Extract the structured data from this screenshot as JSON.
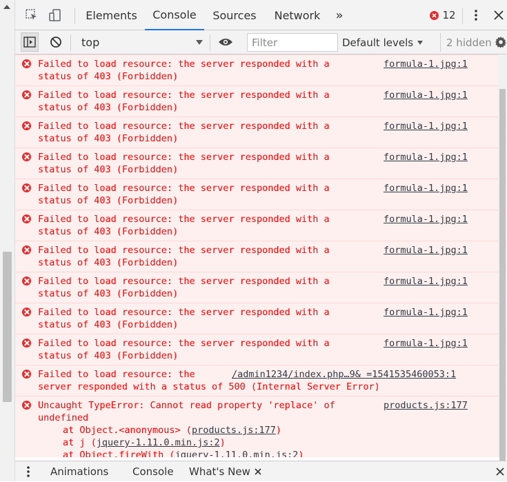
{
  "tabs": [
    {
      "label": "Elements"
    },
    {
      "label": "Console"
    },
    {
      "label": "Sources"
    },
    {
      "label": "Network"
    }
  ],
  "tabs_overflow": "»",
  "error_count": "12",
  "toolbar": {
    "context": "top",
    "filter_placeholder": "Filter",
    "levels": "Default levels",
    "hidden": "2 hidden"
  },
  "messages": [
    {
      "line1": "Failed to load resource: the server responded with a",
      "line2": "status of 403 (Forbidden)",
      "source": "formula-1.jpg:1"
    },
    {
      "line1": "Failed to load resource: the server responded with a",
      "line2": "status of 403 (Forbidden)",
      "source": "formula-1.jpg:1"
    },
    {
      "line1": "Failed to load resource: the server responded with a",
      "line2": "status of 403 (Forbidden)",
      "source": "formula-1.jpg:1"
    },
    {
      "line1": "Failed to load resource: the server responded with a",
      "line2": "status of 403 (Forbidden)",
      "source": "formula-1.jpg:1"
    },
    {
      "line1": "Failed to load resource: the server responded with a",
      "line2": "status of 403 (Forbidden)",
      "source": "formula-1.jpg:1"
    },
    {
      "line1": "Failed to load resource: the server responded with a",
      "line2": "status of 403 (Forbidden)",
      "source": "formula-1.jpg:1"
    },
    {
      "line1": "Failed to load resource: the server responded with a",
      "line2": "status of 403 (Forbidden)",
      "source": "formula-1.jpg:1"
    },
    {
      "line1": "Failed to load resource: the server responded with a",
      "line2": "status of 403 (Forbidden)",
      "source": "formula-1.jpg:1"
    },
    {
      "line1": "Failed to load resource: the server responded with a",
      "line2": "status of 403 (Forbidden)",
      "source": "formula-1.jpg:1"
    },
    {
      "line1": "Failed to load resource: the server responded with a",
      "line2": "status of 403 (Forbidden)",
      "source": "formula-1.jpg:1"
    },
    {
      "line1": "Failed to load resource: the",
      "line2": "server responded with a status of 500 (Internal Server Error)",
      "source": "/admin1234/index.php…9& =1541535460053:1"
    }
  ],
  "uncaught": {
    "line1": "Uncaught TypeError: Cannot read property 'replace' of",
    "line2": "undefined",
    "source": "products.js:177",
    "stack": [
      {
        "prefix": "at Object.<anonymous> (",
        "link": "products.js:177",
        "suffix": ")"
      },
      {
        "prefix": "at j (",
        "link": "jquery-1.11.0.min.js:2",
        "suffix": ")"
      },
      {
        "prefix": "at Object.fireWith (",
        "link": "jquery-1.11.0.min.js:2",
        "suffix": ")"
      }
    ]
  },
  "drawer": {
    "tabs": [
      {
        "label": "Animations"
      },
      {
        "label": "Console"
      },
      {
        "label": "What's New"
      }
    ]
  },
  "colors": {
    "error_text": "#ff0000",
    "error_bg": "#fff0f0",
    "accent": "#1a73e8"
  }
}
